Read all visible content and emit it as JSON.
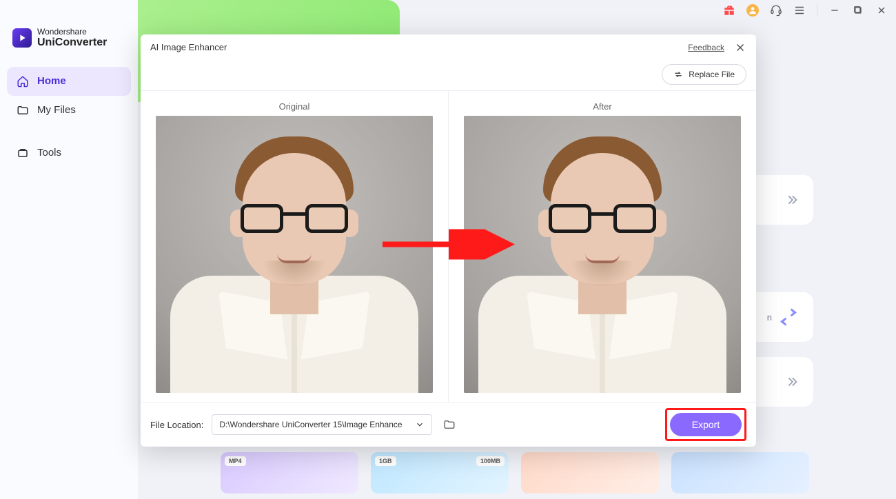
{
  "app": {
    "brand_top": "Wondershare",
    "brand_bottom": "UniConverter"
  },
  "sidebar": {
    "items": [
      {
        "label": "Home"
      },
      {
        "label": "My Files"
      },
      {
        "label": "Tools"
      }
    ]
  },
  "dialog": {
    "title": "AI Image Enhancer",
    "feedback": "Feedback",
    "replace_file": "Replace File",
    "original_label": "Original",
    "after_label": "After",
    "file_location_label": "File Location:",
    "file_location_value": "D:\\Wondershare UniConverter 15\\Image Enhance",
    "export_label": "Export"
  },
  "thumbs": {
    "b1": "MP4",
    "b2": "1GB",
    "b3": "100MB"
  }
}
